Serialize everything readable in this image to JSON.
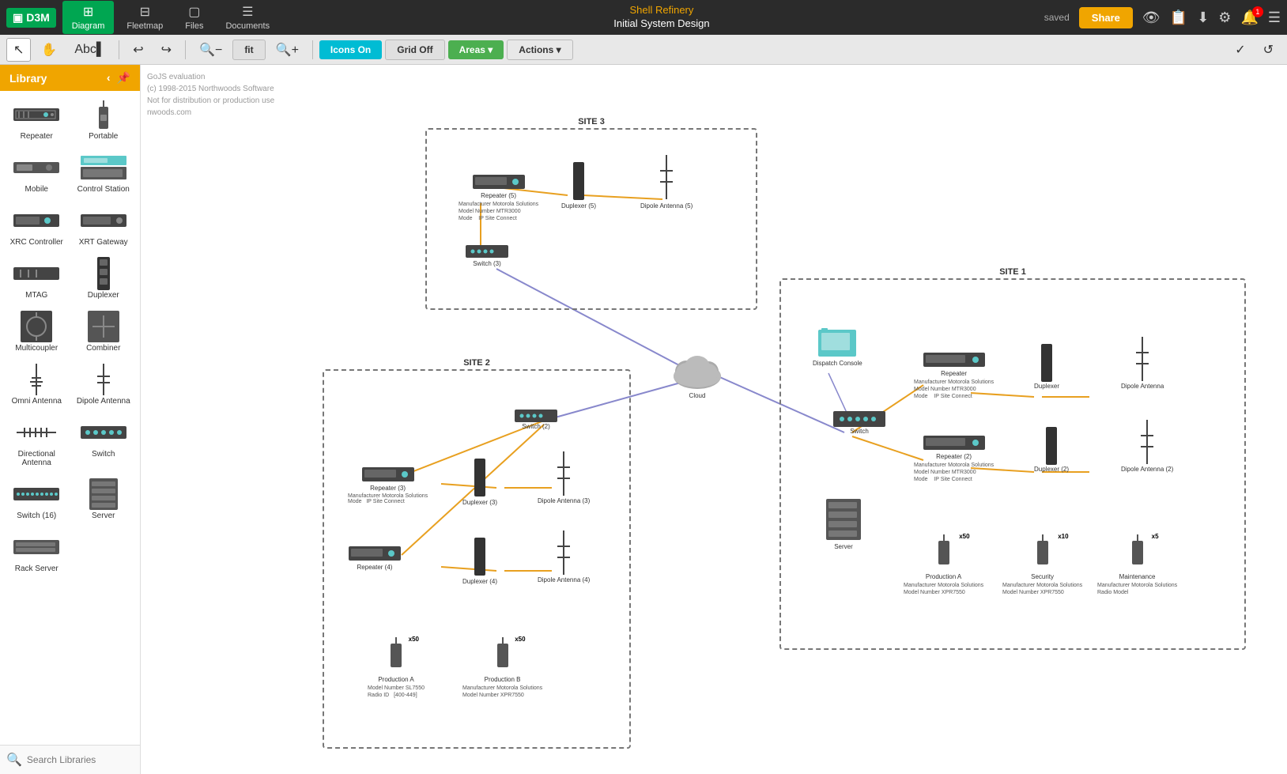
{
  "app": {
    "logo": "D3M",
    "logo_icon": "▣",
    "saved_label": "saved",
    "title_line1": "Shell Refinery",
    "title_line2": "Initial System Design"
  },
  "nav": {
    "items": [
      {
        "id": "diagram",
        "label": "Diagram",
        "icon": "⊞",
        "active": true
      },
      {
        "id": "fleetmap",
        "label": "Fleetmap",
        "icon": "⊟",
        "active": false
      },
      {
        "id": "files",
        "label": "Files",
        "icon": "▢",
        "active": false
      },
      {
        "id": "documents",
        "label": "Documents",
        "icon": "☰",
        "active": false
      }
    ],
    "share_label": "Share",
    "bell_badge": "1"
  },
  "toolbar": {
    "icons_on_label": "Icons On",
    "grid_off_label": "Grid Off",
    "areas_label": "Areas ▾",
    "actions_label": "Actions ▾",
    "fit_label": "fit"
  },
  "sidebar": {
    "title": "Library",
    "items": [
      {
        "id": "repeater",
        "label": "Repeater"
      },
      {
        "id": "portable",
        "label": "Portable"
      },
      {
        "id": "mobile",
        "label": "Mobile"
      },
      {
        "id": "control-station",
        "label": "Control Station"
      },
      {
        "id": "xrc-controller",
        "label": "XRC Controller"
      },
      {
        "id": "xrt-gateway",
        "label": "XRT Gateway"
      },
      {
        "id": "mtag",
        "label": "MTAG"
      },
      {
        "id": "duplexer",
        "label": "Duplexer"
      },
      {
        "id": "multicoupler",
        "label": "Multicoupler"
      },
      {
        "id": "combiner",
        "label": "Combiner"
      },
      {
        "id": "omni-antenna",
        "label": "Omni Antenna"
      },
      {
        "id": "dipole-antenna",
        "label": "Dipole Antenna"
      },
      {
        "id": "directional-antenna",
        "label": "Directional Antenna"
      },
      {
        "id": "switch",
        "label": "Switch"
      },
      {
        "id": "switch-16",
        "label": "Switch (16)"
      },
      {
        "id": "server",
        "label": "Server"
      },
      {
        "id": "rack-server",
        "label": "Rack Server"
      }
    ],
    "search_placeholder": "Search Libraries"
  },
  "diagram": {
    "eval_text": [
      "GoJS evaluation",
      "(c) 1998-2015 Northwoods Software",
      "Not for distribution or production use",
      "nwoods.com"
    ],
    "sites": [
      {
        "id": "site3",
        "label": "SITE 3"
      },
      {
        "id": "site2",
        "label": "SITE 2"
      },
      {
        "id": "site1",
        "label": "SITE 1"
      }
    ]
  },
  "colors": {
    "orange": "#f0a500",
    "teal": "#00bcd4",
    "green": "#4caf50",
    "connection_orange": "#e8a020",
    "connection_blue": "#8888cc"
  }
}
